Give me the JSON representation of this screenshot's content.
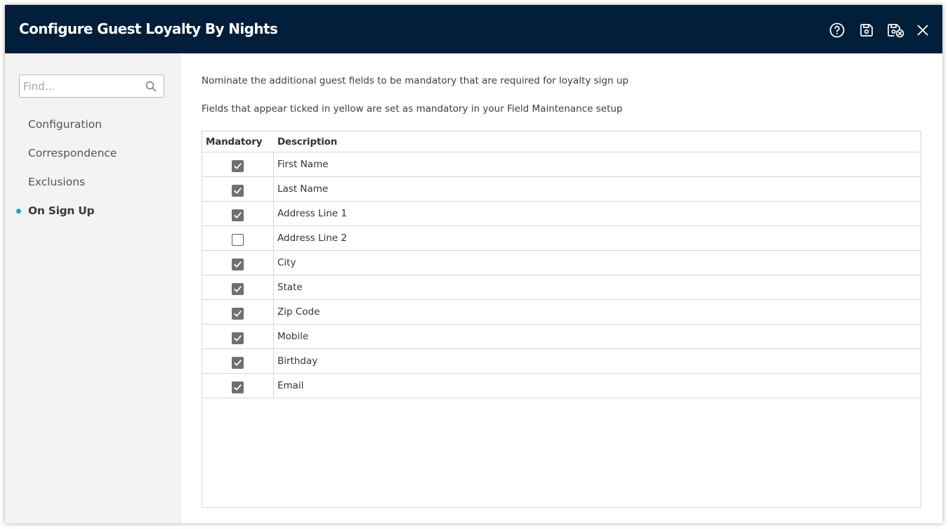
{
  "window": {
    "title": "Configure Guest Loyalty By Nights",
    "header_color": "#011e3a",
    "actions": [
      {
        "name": "help-icon"
      },
      {
        "name": "save-icon"
      },
      {
        "name": "save-close-icon"
      },
      {
        "name": "close-icon"
      }
    ]
  },
  "sidebar": {
    "search_placeholder": "Find...",
    "search_value": "",
    "items": [
      {
        "label": "Configuration",
        "active": false
      },
      {
        "label": "Correspondence",
        "active": false
      },
      {
        "label": "Exclusions",
        "active": false
      },
      {
        "label": "On Sign Up",
        "active": true
      }
    ],
    "active_indicator_color": "#1fa2d6"
  },
  "main": {
    "instruction_1": "Nominate the additional guest fields to be mandatory that are required for loyalty sign up",
    "instruction_2": "Fields that appear ticked in yellow are set as mandatory in your Field Maintenance setup",
    "table": {
      "columns": [
        "Mandatory",
        "Description"
      ],
      "rows": [
        {
          "mandatory": true,
          "description": "First Name"
        },
        {
          "mandatory": true,
          "description": "Last Name"
        },
        {
          "mandatory": true,
          "description": "Address Line 1"
        },
        {
          "mandatory": false,
          "description": "Address Line 2"
        },
        {
          "mandatory": true,
          "description": "City"
        },
        {
          "mandatory": true,
          "description": "State"
        },
        {
          "mandatory": true,
          "description": "Zip Code"
        },
        {
          "mandatory": true,
          "description": "Mobile"
        },
        {
          "mandatory": true,
          "description": "Birthday"
        },
        {
          "mandatory": true,
          "description": "Email"
        }
      ]
    }
  }
}
